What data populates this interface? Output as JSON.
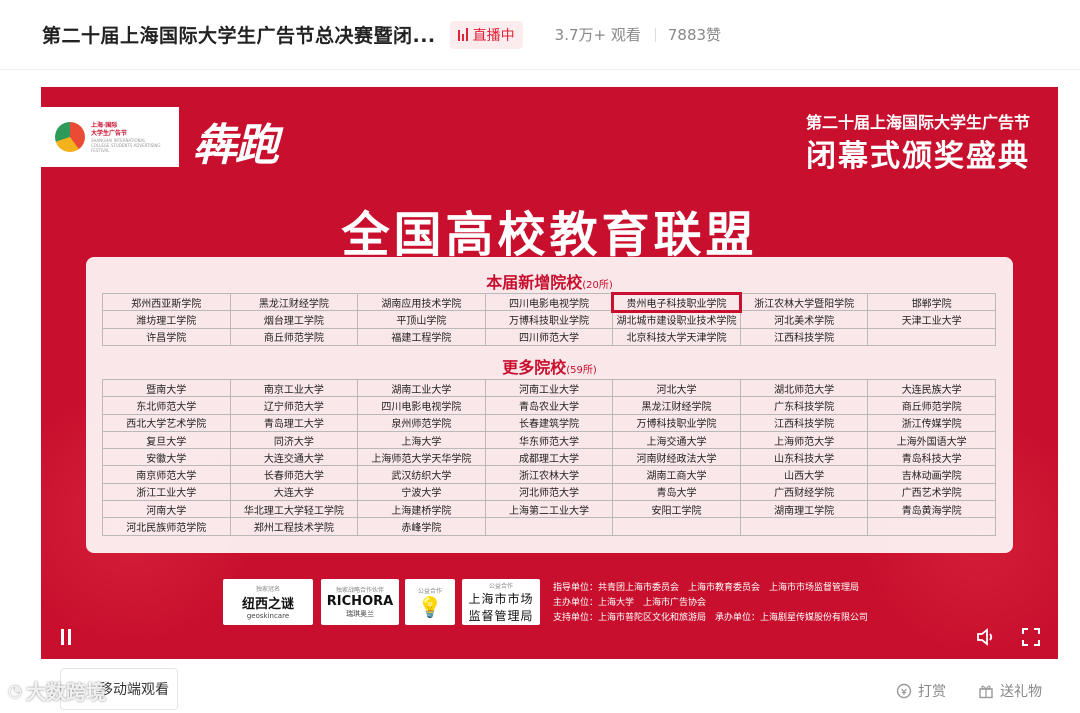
{
  "header": {
    "title": "第二十届上海国际大学生广告节总决赛暨闭...",
    "live_label": "直播中",
    "views": "3.7万+ 观看",
    "likes": "7883赞"
  },
  "slide": {
    "logo_line1": "上海·国际",
    "logo_line2": "大学生广告节",
    "logo_sub": "SHANGHAI INTERNATIONAL COLLEGE STUDENTS ADVERTISING FESTIVAL",
    "brush_slogan": "犇跑",
    "event_top": "第二十届上海国际大学生广告节",
    "event_main": "闭幕式颁奖盛典",
    "main_title": "全国高校教育联盟",
    "section1_title": "本届新增院校",
    "section1_count": "(20所)",
    "section2_title": "更多院校",
    "section2_count": "(59所)",
    "new_schools": [
      [
        "郑州西亚斯学院",
        "黑龙江财经学院",
        "湖南应用技术学院",
        "四川电影电视学院",
        "贵州电子科技职业学院",
        "浙江农林大学暨阳学院",
        "邯郸学院"
      ],
      [
        "潍坊理工学院",
        "烟台理工学院",
        "平顶山学院",
        "万博科技职业学院",
        "湖北城市建设职业技术学院",
        "河北美术学院",
        "天津工业大学"
      ],
      [
        "许昌学院",
        "商丘师范学院",
        "福建工程学院",
        "四川师范大学",
        "北京科技大学天津学院",
        "江西科技学院",
        ""
      ]
    ],
    "more_schools": [
      [
        "暨南大学",
        "南京工业大学",
        "湖南工业大学",
        "河南工业大学",
        "河北大学",
        "湖北师范大学",
        "大连民族大学"
      ],
      [
        "东北师范大学",
        "辽宁师范大学",
        "四川电影电视学院",
        "青岛农业大学",
        "黑龙江财经学院",
        "广东科技学院",
        "商丘师范学院"
      ],
      [
        "西北大学艺术学院",
        "青岛理工大学",
        "泉州师范学院",
        "长春建筑学院",
        "万博科技职业学院",
        "江西科技学院",
        "浙江传媒学院"
      ],
      [
        "复旦大学",
        "同济大学",
        "上海大学",
        "华东师范大学",
        "上海交通大学",
        "上海师范大学",
        "上海外国语大学"
      ],
      [
        "安徽大学",
        "大连交通大学",
        "上海师范大学天华学院",
        "成都理工大学",
        "河南财经政法大学",
        "山东科技大学",
        "青岛科技大学"
      ],
      [
        "南京师范大学",
        "长春师范大学",
        "武汉纺织大学",
        "浙江农林大学",
        "湖南工商大学",
        "山西大学",
        "吉林动画学院"
      ],
      [
        "浙江工业大学",
        "大连大学",
        "宁波大学",
        "河北师范大学",
        "青岛大学",
        "广西财经学院",
        "广西艺术学院"
      ],
      [
        "河南大学",
        "华北理工大学轻工学院",
        "上海建桥学院",
        "上海第二工业大学",
        "安阳工学院",
        "湖南理工学院",
        "青岛黄海学院"
      ],
      [
        "河北民族师范学院",
        "郑州工程技术学院",
        "赤峰学院",
        "",
        "",
        "",
        ""
      ]
    ],
    "sponsors": [
      {
        "caption": "独家冠名",
        "name": "纽西之谜",
        "sub": "geoskincare"
      },
      {
        "caption": "独家战略合作伙伴",
        "name": "RICHORA",
        "sub": "瑞琪奥兰"
      },
      {
        "caption": "公益合作",
        "name": "",
        "sub": ""
      },
      {
        "caption": "公益合作",
        "name": "上海市市场",
        "sub": "监督管理局"
      }
    ],
    "credits": [
      "指导单位：共青团上海市委员会　上海市教育委员会　上海市市场监督管理局",
      "主办单位：上海大学　上海市广告协会",
      "支持单位：上海市普陀区文化和旅游局　承办单位：上海剧星传媒股份有限公司"
    ]
  },
  "bottom": {
    "watermark": "大数跨境",
    "bookmark_label": "移动端观看",
    "reward_label": "打赏",
    "gift_label": "送礼物"
  },
  "colors": {
    "brand_red": "#c8102e",
    "live_red": "#e0233a"
  }
}
